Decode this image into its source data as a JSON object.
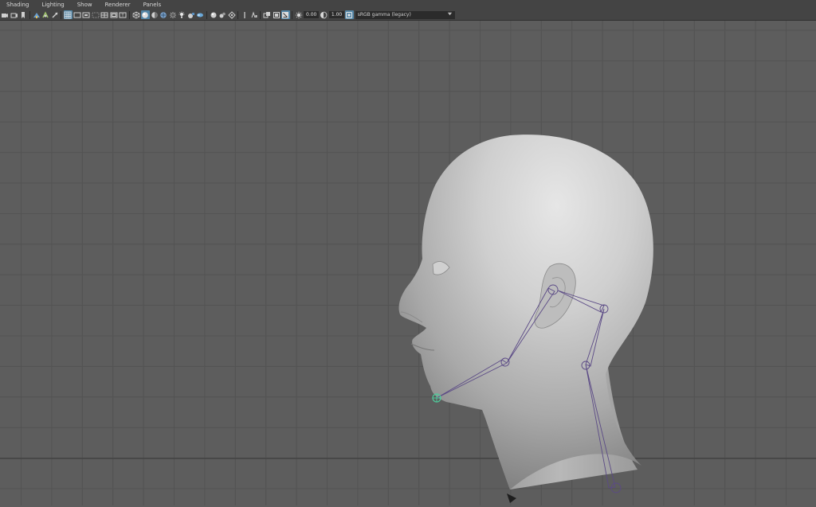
{
  "menubar": {
    "items": [
      {
        "label": "Shading"
      },
      {
        "label": "Lighting"
      },
      {
        "label": "Show"
      },
      {
        "label": "Renderer"
      },
      {
        "label": "Panels"
      }
    ]
  },
  "toolbar": {
    "exposure_value": "0.00",
    "gamma_value": "1.00",
    "color_space": "sRGB gamma (legacy)",
    "icons_group1": [
      "select-camera-icon",
      "camera-attributes-icon",
      "bookmark-icon",
      "image-plane-icon",
      "grease-pencil-icon",
      "two-d-pan-zoom-icon"
    ],
    "icons_group2": [
      "grid-icon",
      "film-gate-icon",
      "resolution-gate-icon",
      "gate-mask-icon",
      "field-chart-icon",
      "safe-action-icon",
      "safe-title-icon"
    ],
    "icons_group3": [
      "wireframe-icon",
      "smooth-shade-icon",
      "default-material-icon",
      "textured-icon",
      "use-all-lights-icon",
      "shadows-icon",
      "screen-space-ao-icon",
      "motion-blur-icon"
    ],
    "icons_group4": [
      "multisample-aa-icon",
      "depth-of-field-icon",
      "isolate-select-icon",
      "xray-icon",
      "xray-active-icon",
      "xray-joints-icon",
      "backface-cull-icon"
    ]
  },
  "colors": {
    "menubar_bg": "#444444",
    "viewport_bg": "#5d5d5d",
    "grid_line": "#535353",
    "joint_color": "#5b4a86",
    "selected_joint": "#4fc99a",
    "active_toggle": "#5285a6"
  }
}
